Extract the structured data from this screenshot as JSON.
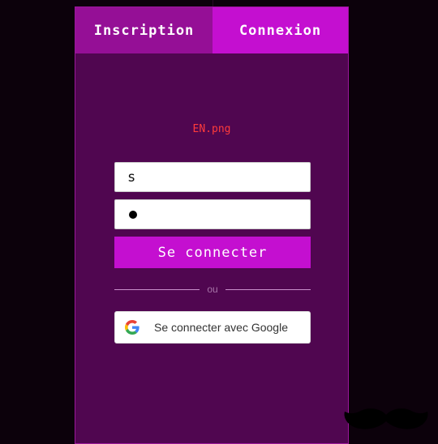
{
  "tabs": [
    {
      "label": "Inscription"
    },
    {
      "label": "Connexion"
    }
  ],
  "logo": {
    "alt_text": "EN.png"
  },
  "form": {
    "username_value": "s",
    "password_masked": "●",
    "submit_label": "Se connecter"
  },
  "separator": {
    "text": "ou"
  },
  "google": {
    "label": "Se connecter avec Google",
    "icon": "google-g-icon"
  },
  "decoration": {
    "icon": "mustache-icon"
  },
  "colors": {
    "background": "#0c010b",
    "panel": "#500650",
    "tab_inactive": "#950f96",
    "accent": "#c40fd0",
    "logo_text": "#ff3b3b"
  }
}
